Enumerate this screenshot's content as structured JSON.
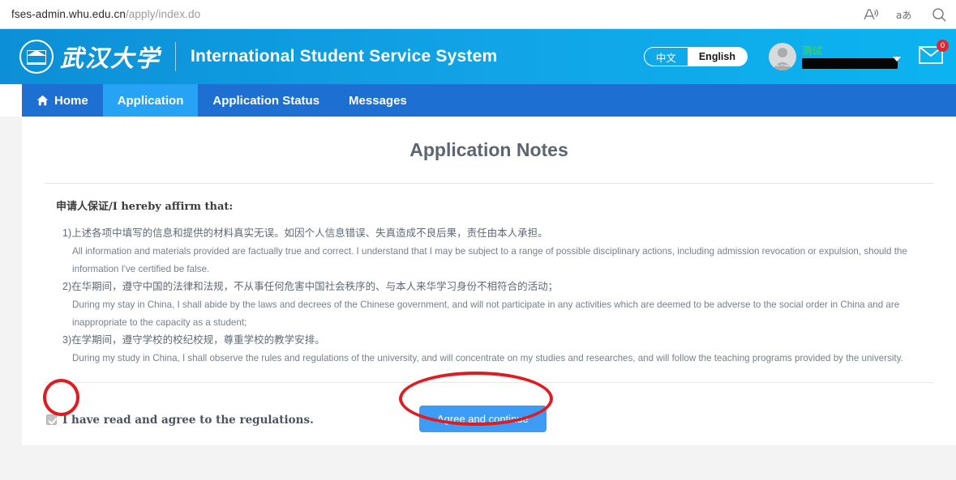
{
  "browser": {
    "url_domain": "fses-admin.whu.edu.cn",
    "url_path": "/apply/index.do",
    "icons": [
      {
        "name": "read-aloud-icon",
        "glyph": "A"
      },
      {
        "name": "translate-icon",
        "glyph": "aあ"
      },
      {
        "name": "find-on-page-icon",
        "glyph": "search"
      }
    ]
  },
  "header": {
    "logo_cn": "武汉大学",
    "site_title": "International Student Service System",
    "language": {
      "chinese_label": "中文",
      "english_label": "English",
      "selected": "English"
    },
    "user": {
      "name": "测试",
      "avatar_label": "No Photo",
      "id_redacted": ""
    },
    "messages_badge": "0"
  },
  "nav": {
    "items": [
      {
        "label": "Home",
        "icon": "home-icon",
        "active": false
      },
      {
        "label": "Application",
        "icon": "",
        "active": true
      },
      {
        "label": "Application Status",
        "icon": "",
        "active": false
      },
      {
        "label": "Messages",
        "icon": "",
        "active": false
      }
    ]
  },
  "main": {
    "page_title": "Application Notes",
    "affirm_heading": "申请人保证/I hereby affirm that:",
    "clauses": [
      {
        "cn": "1)上述各项中填写的信息和提供的材料真实无误。如因个人信息错误、失真造成不良后果，责任由本人承担。",
        "en": "All information and materials provided are factually true and correct. I understand that I may be subject to a range of possible disciplinary actions, including admission revocation or expulsion, should the information I've certified be false."
      },
      {
        "cn": "2)在华期间，遵守中国的法律和法规，不从事任何危害中国社会秩序的、与本人来华学习身份不相符合的活动；",
        "en": "During my stay in China, I shall abide by the laws and decrees of the Chinese government, and will not participate in any activities which are deemed to be adverse to the social order in China and are inappropriate to the capacity as a student;"
      },
      {
        "cn": "3)在学期间，遵守学校的校纪校规，尊重学校的教学安排。",
        "en": "During my study in China, I shall observe the rules and regulations of the university, and will concentrate on my studies and researches, and will follow the teaching programs provided by the university."
      }
    ],
    "agree_checkbox_checked": true,
    "agree_text": "I have read and agree to the regulations.",
    "agree_button": "Agree and continue"
  },
  "colors": {
    "header_blue": "#11a4e6",
    "nav_blue": "#1d6fd2",
    "nav_active_blue": "#26a3f5",
    "button_blue": "#3d9cf5",
    "badge_red": "#e4262c",
    "annotation_red": "#e01c23",
    "username_green": "#2ecc8f",
    "page_bg": "#f3f3f3"
  }
}
